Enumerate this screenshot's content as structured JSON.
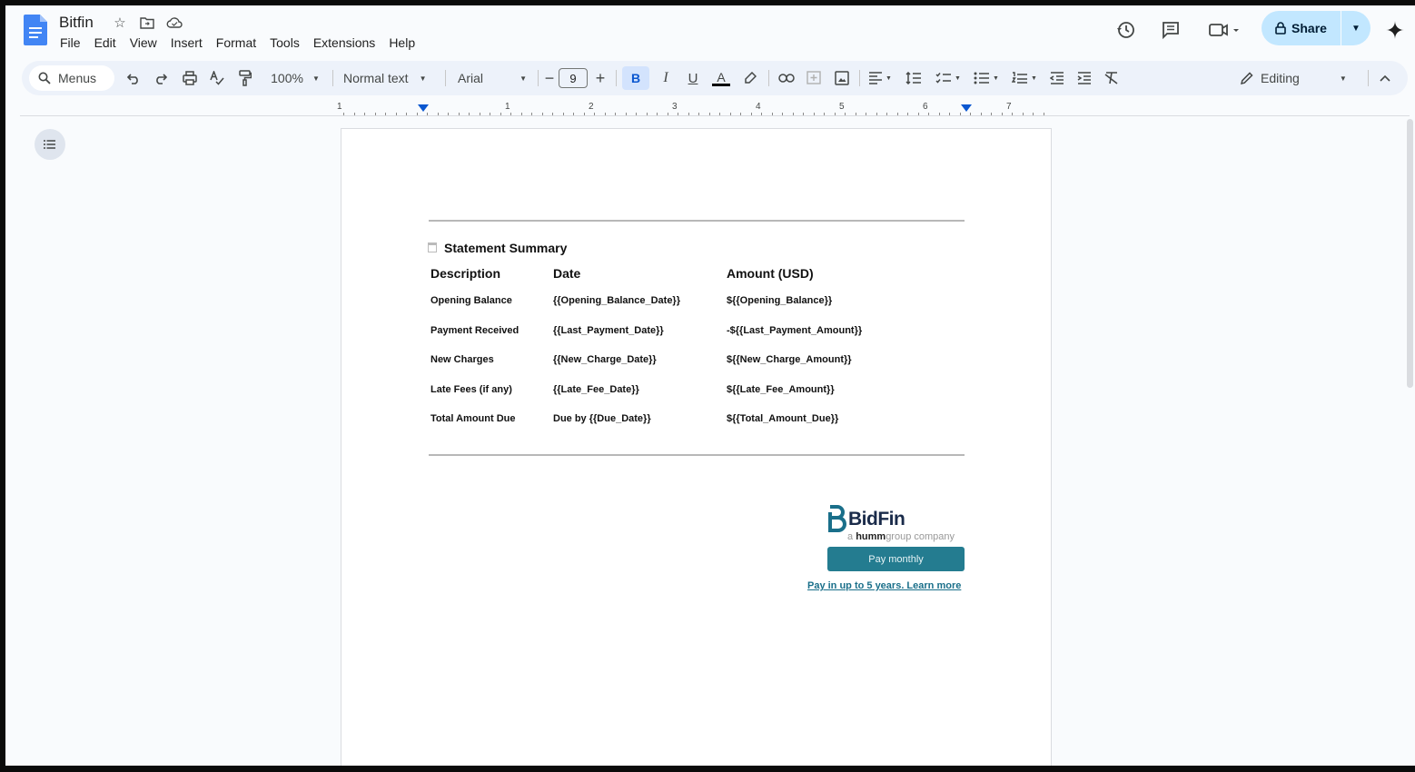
{
  "app": {
    "doc_title": "Bitfin",
    "menu": [
      "File",
      "Edit",
      "View",
      "Insert",
      "Format",
      "Tools",
      "Extensions",
      "Help"
    ],
    "share_label": "Share"
  },
  "toolbar": {
    "search_label": "Menus",
    "zoom": "100%",
    "style": "Normal text",
    "font": "Arial",
    "font_size": "9",
    "bold": "B",
    "italic": "I",
    "underline": "U",
    "text_color": "A",
    "mode": "Editing"
  },
  "ruler": {
    "numbers": [
      "1",
      "1",
      "2",
      "3",
      "4",
      "5",
      "6",
      "7"
    ]
  },
  "document": {
    "section_title": "Statement Summary",
    "headers": [
      "Description",
      "Date",
      "Amount (USD)"
    ],
    "rows": [
      [
        "Opening Balance",
        "{{Opening_Balance_Date}}",
        "${{Opening_Balance}}"
      ],
      [
        "Payment Received",
        "{{Last_Payment_Date}}",
        "-${{Last_Payment_Amount}}"
      ],
      [
        "New Charges",
        "{{New_Charge_Date}}",
        "${{New_Charge_Amount}}"
      ],
      [
        "Late Fees (if any)",
        "{{Late_Fee_Date}}",
        "${{Late_Fee_Amount}}"
      ],
      [
        "Total Amount Due",
        "Due by {{Due_Date}}",
        "${{Total_Amount_Due}}"
      ]
    ],
    "promo": {
      "brand": "BidFin",
      "tagline_prefix": "a ",
      "tagline_brand": "humm",
      "tagline_suffix": "group company",
      "button": "Pay monthly",
      "link": "Pay in up to 5 years. Learn more"
    }
  },
  "colors": {
    "accent": "#0b57d0",
    "share_bg": "#c2e7ff",
    "promo_button": "#247c90"
  }
}
